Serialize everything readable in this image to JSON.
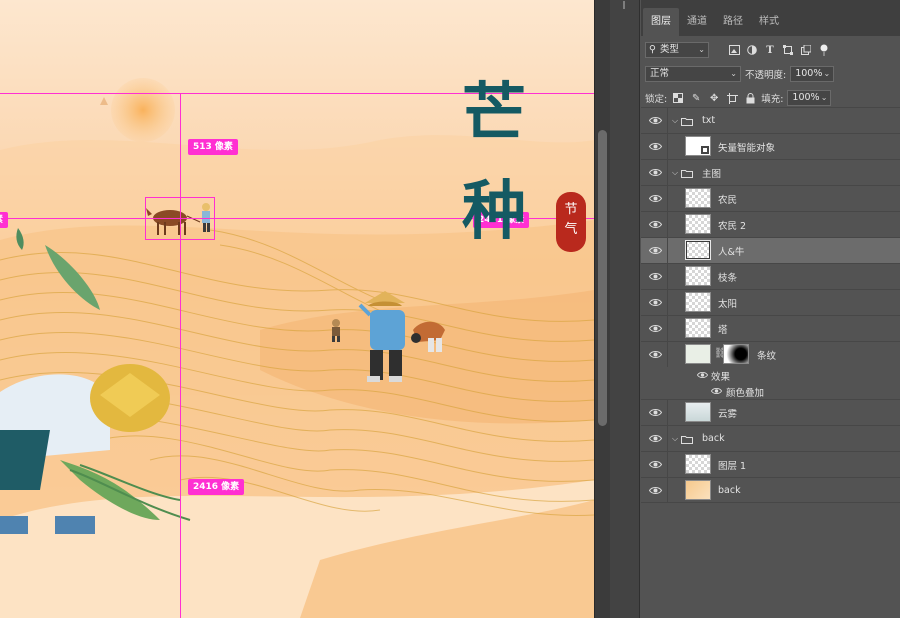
{
  "canvas": {
    "title_chars": [
      "芒",
      "种"
    ],
    "seal_chars": [
      "节",
      "气"
    ],
    "measurements": {
      "top": "513 像素",
      "right": "2451 像素",
      "bottom": "2416 像素",
      "left": "像素"
    },
    "colors": {
      "guide": "#ff2fd2",
      "title": "#155a63",
      "seal": "#b9291d"
    }
  },
  "panel": {
    "tabs": [
      "图层",
      "通道",
      "路径",
      "样式"
    ],
    "active_tab": "图层",
    "filter": {
      "value": "类型",
      "icon": "search-icon"
    },
    "blend_mode": "正常",
    "opacity_label": "不透明度:",
    "opacity_value": "100%",
    "lock_label": "锁定:",
    "fill_label": "填充:",
    "fill_value": "100%",
    "layers": [
      {
        "name": "txt",
        "kind": "group",
        "expanded": true
      },
      {
        "name": "矢量智能对象",
        "kind": "smart-object"
      },
      {
        "name": "主图",
        "kind": "group",
        "expanded": true
      },
      {
        "name": "农民",
        "kind": "layer"
      },
      {
        "name": "农民 2",
        "kind": "layer"
      },
      {
        "name": "人&牛",
        "kind": "layer",
        "selected": true
      },
      {
        "name": "枝条",
        "kind": "layer"
      },
      {
        "name": "太阳",
        "kind": "layer"
      },
      {
        "name": "塔",
        "kind": "layer"
      },
      {
        "name": "条纹",
        "kind": "masked-layer"
      },
      {
        "name": "效果",
        "kind": "effects"
      },
      {
        "name": "颜色叠加",
        "kind": "effect"
      },
      {
        "name": "云雾",
        "kind": "layer"
      },
      {
        "name": "back",
        "kind": "group",
        "expanded": true
      },
      {
        "name": "图层 1",
        "kind": "layer"
      },
      {
        "name": "back",
        "kind": "layer",
        "thumb": "orange"
      }
    ]
  }
}
